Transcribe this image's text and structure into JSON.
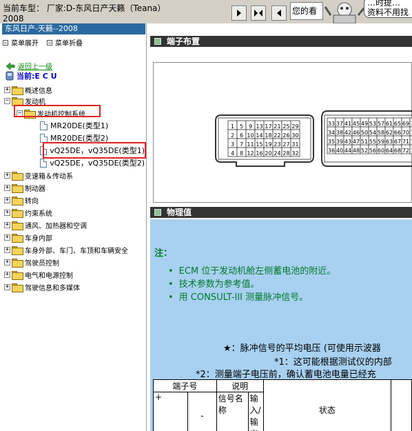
{
  "topbar": {
    "vehicle_label": "当前车型：  厂家:D-东风日产天籁（Teana）",
    "vehicle_year": "2008",
    "nav_buttons": [
      "next-icon",
      "expand-icon",
      "prev-icon"
    ],
    "tip_text": "您的看",
    "bubble_text": "…时提…\n资料不用找"
  },
  "left": {
    "title": "东风日产-天籁--2008",
    "menu_expand": "菜单展开",
    "menu_collapse": "菜单折叠",
    "back_link": "返回上一级",
    "current_ecu": "当前:E C U",
    "tree": [
      {
        "label": "概述信息",
        "sign": "+"
      },
      {
        "label": "发动机",
        "sign": "−"
      },
      {
        "label": "发动机控制系统",
        "sign": "−"
      },
      {
        "label": "MR20DE(类型1)"
      },
      {
        "label": "MR20DE(类型2)"
      },
      {
        "label": "vQ25DE，vQ35DE(类型1)"
      },
      {
        "label": "vQ25DE，vQ35DE(类型2)"
      },
      {
        "label": "变速箱＆传动系",
        "sign": "+"
      },
      {
        "label": "制动器",
        "sign": "+"
      },
      {
        "label": "转向",
        "sign": "+"
      },
      {
        "label": "约束系统",
        "sign": "+"
      },
      {
        "label": "通风、加热器和空调",
        "sign": "+"
      },
      {
        "label": "车身内部",
        "sign": "+"
      },
      {
        "label": "车身外部、车门、车顶和车辆安全",
        "sign": "+"
      },
      {
        "label": "驾驶员控制",
        "sign": "+"
      },
      {
        "label": "电气和电源控制",
        "sign": "+"
      },
      {
        "label": "驾驶信息和多媒体",
        "sign": "+"
      }
    ]
  },
  "right": {
    "section1_title": "端子布置",
    "section2_title": "物理值",
    "note_title": "注：",
    "bullets": [
      "ECM 位于发动机舱左侧蓄电池的附近。",
      "技术参数为参考值。",
      "用 CONSULT-III 测量脉冲信号。"
    ],
    "foot1": "★：脉冲信号的平均电压 (可使用示波器",
    "foot2": "*1：这可能根据测试仪的内部",
    "foot3": "*2：测量端子电压前，确认蓄电池电量已经充",
    "table": {
      "h_terminal": "端子号",
      "h_desc": "说明",
      "plus": "+",
      "minus": "-",
      "signal_name": "信号名称",
      "io": "输入/输出",
      "state": "状态"
    },
    "connector_left_rows": [
      [
        "1",
        "5",
        "9",
        "13",
        "17",
        "21",
        "25",
        "29"
      ],
      [
        "2",
        "6",
        "10",
        "14",
        "18",
        "22",
        "26",
        "30"
      ],
      [
        "3",
        "7",
        "11",
        "15",
        "19",
        "23",
        "27",
        "31"
      ],
      [
        "4",
        "8",
        "12",
        "16",
        "20",
        "24",
        "28",
        "32"
      ]
    ],
    "connector_right_rows": [
      [
        "33",
        "37",
        "41",
        "45",
        "49",
        "53",
        "57",
        "61",
        "65",
        "69",
        "73"
      ],
      [
        "34",
        "38",
        "42",
        "46",
        "50",
        "54",
        "58",
        "62",
        "66",
        "70",
        "74"
      ],
      [
        "35",
        "39",
        "43",
        "47",
        "51",
        "55",
        "59",
        "63",
        "67",
        "71",
        "75"
      ],
      [
        "36",
        "40",
        "44",
        "48",
        "52",
        "56",
        "60",
        "64",
        "68",
        "72",
        "76"
      ]
    ]
  },
  "colors": {
    "title_bar": "#2a6aa0",
    "section_header": "#333333",
    "note_green": "#007a2a",
    "blue_bg": "#a8d0f0",
    "highlight_red": "#e02020"
  }
}
